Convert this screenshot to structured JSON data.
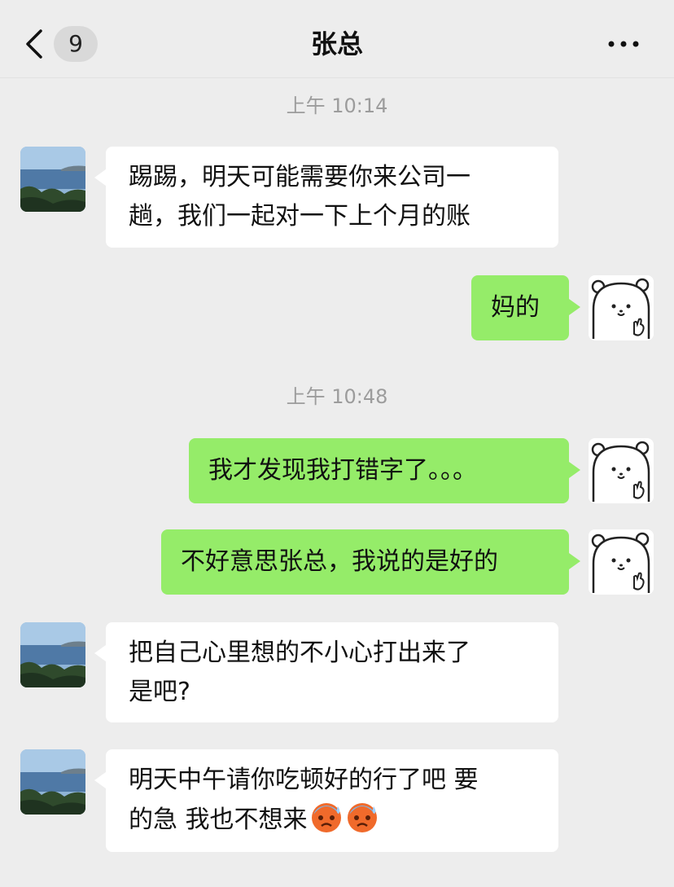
{
  "header": {
    "title": "张总",
    "unread_count": "9"
  },
  "messages": [
    {
      "kind": "timestamp",
      "text": "上午 10:14"
    },
    {
      "kind": "incoming",
      "lines": [
        "踢踢，明天可能需要你来公司一",
        "趟，我们一起对一下上个月的账"
      ]
    },
    {
      "kind": "outgoing",
      "text": "妈的"
    },
    {
      "kind": "timestamp",
      "text": "上午 10:48"
    },
    {
      "kind": "outgoing",
      "text": "我才发现我打错字了。。。"
    },
    {
      "kind": "outgoing",
      "text": "不好意思张总，我说的是好的"
    },
    {
      "kind": "incoming",
      "lines": [
        "把自己心里想的不小心打出来了",
        "是吧?"
      ]
    },
    {
      "kind": "incoming",
      "lines": [
        "明天中午请你吃顿好的行了吧 要",
        "的急 我也不想来"
      ],
      "trailing_emojis": [
        "cold-sweat-face-icon",
        "cold-sweat-face-icon"
      ]
    }
  ],
  "colors": {
    "background": "#ededed",
    "outgoing_bubble": "#95ec69",
    "incoming_bubble": "#ffffff",
    "timestamp": "#9c9c9c"
  },
  "icons": {
    "back": "chevron-left-icon",
    "more": "more-dots-icon",
    "contact_avatar": "seascape-avatar",
    "self_avatar": "white-bear-avatar"
  }
}
